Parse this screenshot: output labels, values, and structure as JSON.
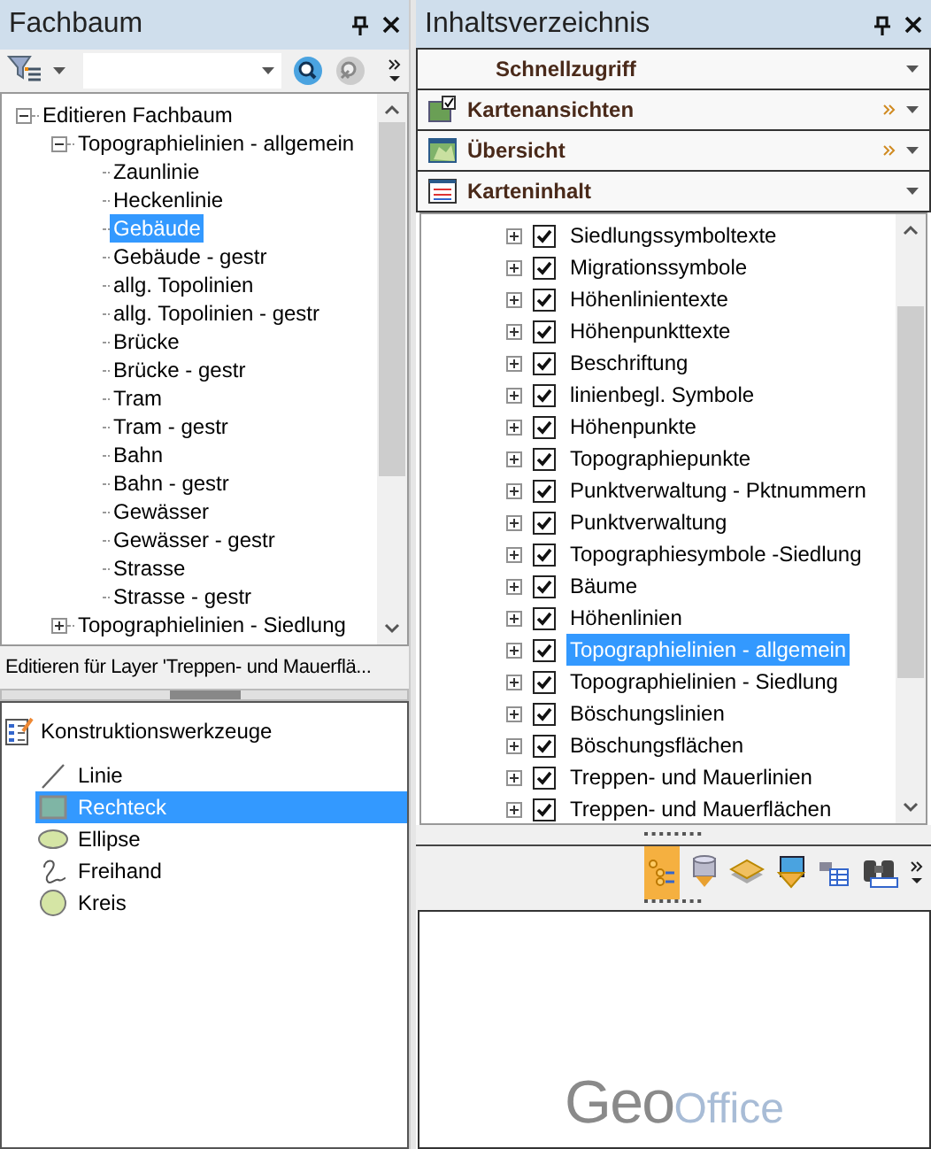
{
  "left_panel": {
    "title": "Fachbaum",
    "tree": [
      {
        "label": "Editieren Fachbaum",
        "selected": false,
        "expanded": true,
        "children": [
          {
            "label": "Topographielinien - allgemein",
            "selected": false,
            "expanded": true,
            "children": [
              {
                "label": "Zaunlinie",
                "selected": false
              },
              {
                "label": "Heckenlinie",
                "selected": false
              },
              {
                "label": "Gebäude",
                "selected": true
              },
              {
                "label": "Gebäude - gestr",
                "selected": false
              },
              {
                "label": "allg. Topolinien",
                "selected": false
              },
              {
                "label": "allg. Topolinien - gestr",
                "selected": false
              },
              {
                "label": "Brücke",
                "selected": false
              },
              {
                "label": "Brücke - gestr",
                "selected": false
              },
              {
                "label": "Tram",
                "selected": false
              },
              {
                "label": "Tram - gestr",
                "selected": false
              },
              {
                "label": "Bahn",
                "selected": false
              },
              {
                "label": "Bahn - gestr",
                "selected": false
              },
              {
                "label": "Gewässer",
                "selected": false
              },
              {
                "label": "Gewässer - gestr",
                "selected": false
              },
              {
                "label": "Strasse",
                "selected": false
              },
              {
                "label": "Strasse - gestr",
                "selected": false
              }
            ]
          },
          {
            "label": "Topographielinien - Siedlung",
            "selected": false,
            "expanded": false
          }
        ]
      }
    ],
    "status": "Editieren für Layer 'Treppen- und Mauerflä...",
    "tools_title": "Konstruktionswerkzeuge",
    "tools": [
      {
        "label": "Linie",
        "kind": "line",
        "selected": false
      },
      {
        "label": "Rechteck",
        "kind": "rect",
        "selected": true
      },
      {
        "label": "Ellipse",
        "kind": "ellipse",
        "selected": false
      },
      {
        "label": "Freihand",
        "kind": "freehand",
        "selected": false
      },
      {
        "label": "Kreis",
        "kind": "circle",
        "selected": false
      }
    ]
  },
  "right_panel": {
    "title": "Inhaltsverzeichnis",
    "sections": [
      {
        "label": "Schnellzugriff",
        "kind": "plain",
        "more": false
      },
      {
        "label": "Kartenansichten",
        "kind": "views",
        "more": true
      },
      {
        "label": "Übersicht",
        "kind": "overview",
        "more": true
      },
      {
        "label": "Karteninhalt",
        "kind": "content",
        "more": false
      }
    ],
    "layers": [
      {
        "label": "Siedlungssymboltexte",
        "checked": true,
        "selected": false
      },
      {
        "label": "Migrationssymbole",
        "checked": true,
        "selected": false
      },
      {
        "label": "Höhenlinientexte",
        "checked": true,
        "selected": false
      },
      {
        "label": "Höhenpunkttexte",
        "checked": true,
        "selected": false
      },
      {
        "label": "Beschriftung",
        "checked": true,
        "selected": false
      },
      {
        "label": "linienbegl. Symbole",
        "checked": true,
        "selected": false
      },
      {
        "label": "Höhenpunkte",
        "checked": true,
        "selected": false
      },
      {
        "label": "Topographiepunkte",
        "checked": true,
        "selected": false
      },
      {
        "label": "Punktverwaltung - Pktnummern",
        "checked": true,
        "selected": false
      },
      {
        "label": "Punktverwaltung",
        "checked": true,
        "selected": false
      },
      {
        "label": "Topographiesymbole -Siedlung",
        "checked": true,
        "selected": false
      },
      {
        "label": "Bäume",
        "checked": true,
        "selected": false
      },
      {
        "label": "Höhenlinien",
        "checked": true,
        "selected": false
      },
      {
        "label": "Topographielinien - allgemein",
        "checked": true,
        "selected": true
      },
      {
        "label": "Topographielinien - Siedlung",
        "checked": true,
        "selected": false
      },
      {
        "label": "Böschungslinien",
        "checked": true,
        "selected": false
      },
      {
        "label": "Böschungsflächen",
        "checked": true,
        "selected": false
      },
      {
        "label": "Treppen- und Mauerlinien",
        "checked": true,
        "selected": false
      },
      {
        "label": "Treppen- und Mauerflächen",
        "checked": true,
        "selected": false
      }
    ],
    "logo": {
      "part_1": "Geo",
      "part_2": "Office"
    }
  }
}
